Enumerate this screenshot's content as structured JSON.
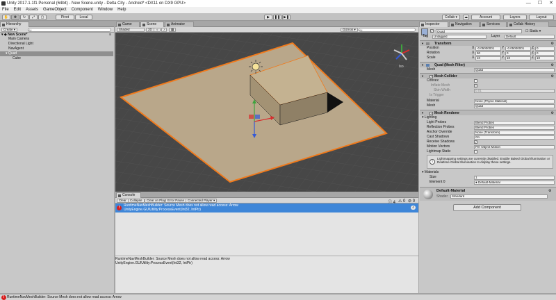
{
  "window": {
    "title": "Unity 2017.1.1f1 Personal (64bit) - New Scene.unity - Delta City - Android* <DX11 on DX9 GPU>",
    "controls": [
      "—",
      "☐",
      "✕"
    ]
  },
  "menu": [
    "File",
    "Edit",
    "Assets",
    "GameObject",
    "Component",
    "Window",
    "Help"
  ],
  "toolbar": {
    "pivot": "Pivot",
    "local": "Local",
    "play": "▶",
    "pause": "❚❚",
    "step": "▶❚",
    "collab": "Collab ▾",
    "account": "Account",
    "layers": "Layers",
    "layout": "Layout"
  },
  "hierarchy": {
    "tab": "Hierarchy",
    "create": "Create ▾",
    "search_placeholder": "All",
    "scene": "New Scene*",
    "items": [
      "Main Camera",
      "Directional Light",
      "NavAgent",
      "Quad",
      "Cube"
    ]
  },
  "scene": {
    "tabs": [
      "Game",
      "Scene",
      "Animator"
    ],
    "shading": "Shaded",
    "mode_2d": "2D",
    "gizmos": "Gizmos ▾",
    "search_placeholder": "All",
    "persp": "Iso"
  },
  "console": {
    "tab": "Console",
    "buttons": [
      "Clear",
      "Collapse",
      "Clear on Play",
      "Error Pause",
      "Connected Player ▾"
    ],
    "counts": [
      "4",
      "0",
      "0"
    ],
    "error_line1": "RuntimeNavMeshBuilder: Source Mesh does not allow read access: Arrow",
    "error_line2": "UnityEngine.GUIUtility:ProcessEvent(Int32, IntPtr)",
    "error_count": "4",
    "detail_line1": "RuntimeNavMeshBuilder: Source Mesh does not allow read access: Arrow",
    "detail_line2": "UnityEngine.GUIUtility:ProcessEvent(Int32, IntPtr)"
  },
  "inspector": {
    "tabs": [
      "Inspector",
      "Navigation",
      "Services",
      "Collab History"
    ],
    "object_name": "Quad",
    "static_label": "Static ▾",
    "tag_label": "Tag",
    "tag_value": "Untagged",
    "layer_label": "Layer",
    "layer_value": "Default",
    "transform": {
      "title": "Transform",
      "position_label": "Position",
      "rotation_label": "Rotation",
      "scale_label": "Scale",
      "position": [
        "-0.05000001",
        "-0.05000001",
        "0"
      ],
      "rotation": [
        "90",
        "0",
        "0"
      ],
      "scale": [
        "10",
        "10",
        "10"
      ]
    },
    "mesh_filter": {
      "title": "Quad (Mesh Filter)",
      "mesh_label": "Mesh",
      "mesh_value": "Quad"
    },
    "mesh_collider": {
      "title": "Mesh Collider",
      "convex_label": "Convex",
      "inflate_label": "Inflate Mesh",
      "skin_label": "Skin Width",
      "skin_value": "0.01",
      "trigger_label": "Is Trigger",
      "material_label": "Material",
      "material_value": "None (Physic Material)",
      "mesh_label": "Mesh",
      "mesh_value": "Quad"
    },
    "mesh_renderer": {
      "title": "Mesh Renderer",
      "lighting_label": "Lighting",
      "light_probes_label": "Light Probes",
      "light_probes_value": "Blend Probes",
      "reflection_label": "Reflection Probes",
      "reflection_value": "Blend Probes",
      "anchor_label": "Anchor Override",
      "anchor_value": "None (Transform)",
      "cast_label": "Cast Shadows",
      "cast_value": "On",
      "receive_label": "Receive Shadows",
      "motion_label": "Motion Vectors",
      "motion_value": "Per Object Motion",
      "lightmap_label": "Lightmap Static",
      "info": "Lightmapping settings are currently disabled. Enable Baked Global Illumination or Realtime Global Illumination to display these settings.",
      "materials_label": "Materials",
      "size_label": "Size",
      "size_value": "1",
      "element_label": "Element 0",
      "element_value": "Default-Material"
    },
    "material": {
      "name": "Default-Material",
      "shader_label": "Shader",
      "shader_value": "Standard"
    },
    "add_component": "Add Component"
  },
  "status": {
    "message": "RuntimeNavMeshBuilder: Source Mesh does not allow read access: Arrow"
  },
  "colors": {
    "selection_outline": "#f07a1c",
    "plane": "#b9a78a",
    "scene_bg": "#474747",
    "console_selected": "#3e86d8",
    "error_red": "#d81f1f"
  }
}
